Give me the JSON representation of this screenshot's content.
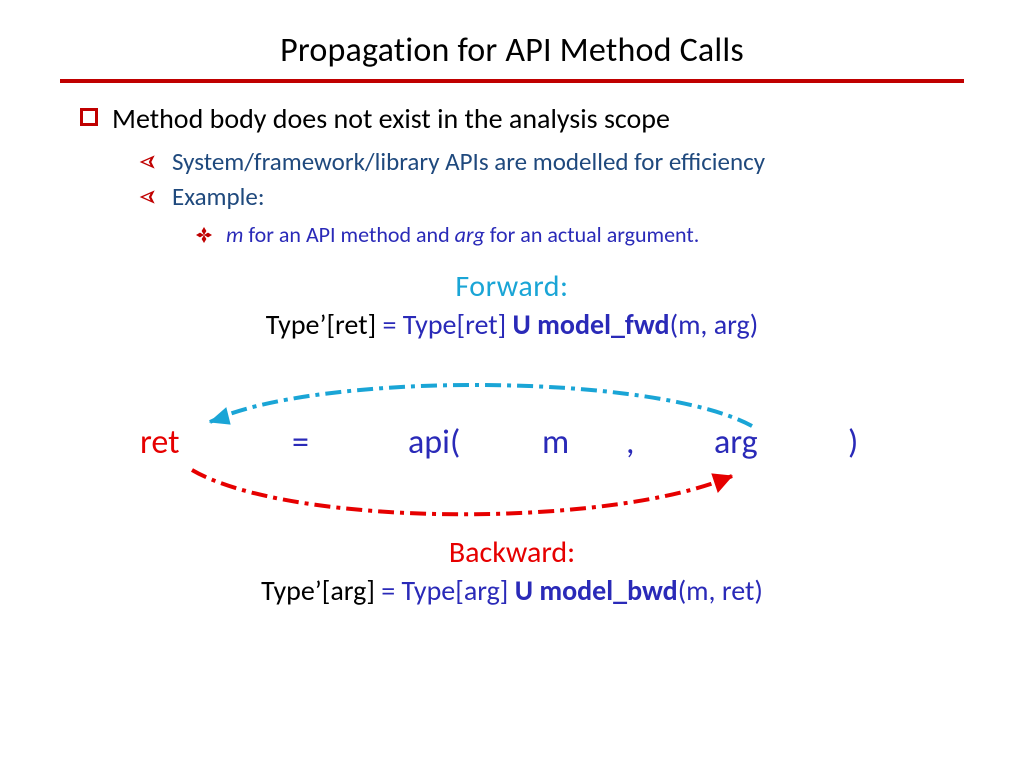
{
  "title": "Propagation for API Method Calls",
  "bullets": {
    "level1": "Method body does not exist in the analysis scope",
    "level2a": "System/framework/library APIs are modelled for efficiency",
    "level2b": "Example:",
    "level3_pre": "m",
    "level3_mid": " for an API method and ",
    "level3_arg": "arg",
    "level3_post": " for an actual argument."
  },
  "labels": {
    "forward": "Forward:",
    "backward": "Backward:"
  },
  "fwd_formula": {
    "lhs": "Type’[ret]",
    "eqspace": " ",
    "eq": "=",
    "rhs_type": " Type[ret] ",
    "union": "U",
    "model": " model_fwd",
    "args": "(m, arg)"
  },
  "bwd_formula": {
    "lhs": "Type’[arg]",
    "eq": "=",
    "rhs_type": " Type[arg] ",
    "union": "U",
    "model": " model_bwd",
    "args": "(m, ret)"
  },
  "eq_tokens": {
    "ret": "ret",
    "eq": "=",
    "api": "api(",
    "m": "m",
    "comma": ",",
    "arg": "arg",
    "close": ")"
  }
}
